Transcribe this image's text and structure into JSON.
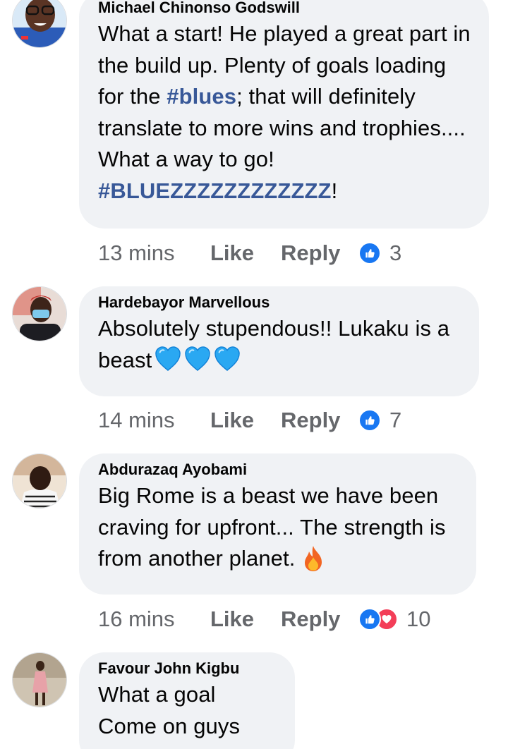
{
  "comments": [
    {
      "author": "Michael Chinonso Godswill",
      "body_segments": [
        "What a start! He played a great part in the build up. Plenty of goals loading for the ",
        "#blues",
        "; that will definitely translate to more wins and trophies.... What a way to go! ",
        "#BLUEZZZZZZZZZZZZ",
        "!"
      ],
      "time": "13 mins",
      "like_label": "Like",
      "reply_label": "Reply",
      "reaction_count": "3",
      "reactions": [
        "like-icon"
      ]
    },
    {
      "author": "Hardebayor Marvellous",
      "body": "Absolutely stupendous!! Lukaku is a beast",
      "emoji": [
        "blue-heart-icon",
        "blue-heart-icon",
        "blue-heart-icon"
      ],
      "time": "14 mins",
      "like_label": "Like",
      "reply_label": "Reply",
      "reaction_count": "7",
      "reactions": [
        "like-icon"
      ]
    },
    {
      "author": "Abdurazaq Ayobami",
      "body": "Big Rome is a beast we have been craving for upfront... The strength is from another planet.",
      "emoji": [
        "fire-icon"
      ],
      "time": "16 mins",
      "like_label": "Like",
      "reply_label": "Reply",
      "reaction_count": "10",
      "reactions": [
        "like-icon",
        "love-icon"
      ]
    },
    {
      "author": "Favour John Kigbu",
      "body_lines": [
        "What a goal",
        "Come on guys"
      ]
    }
  ],
  "colors": {
    "bubble": "#f0f2f5",
    "hashtag": "#385898",
    "meta": "#65676b",
    "like_blue": "#1877f2",
    "love_red": "#f33e58",
    "heart_blue": "#1ea5f2"
  }
}
